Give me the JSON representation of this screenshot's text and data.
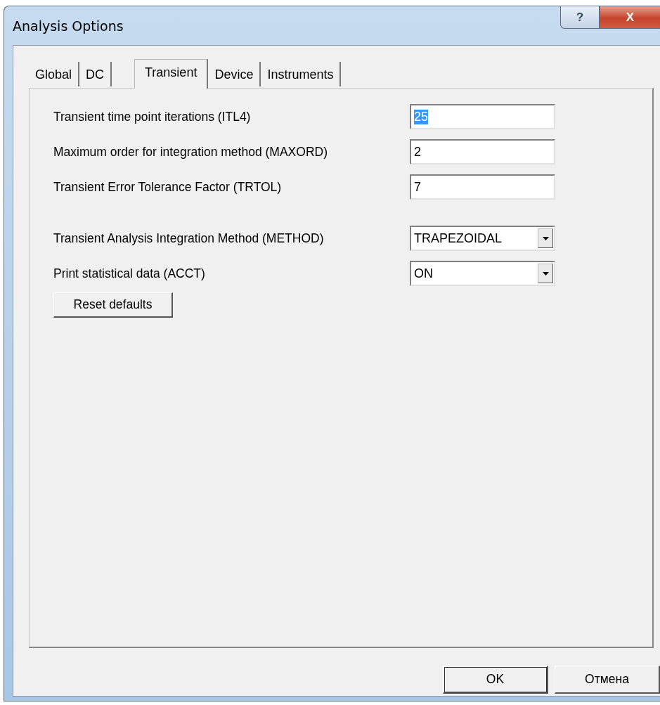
{
  "window": {
    "title": "Analysis Options",
    "buttons": [
      {
        "kind": "help",
        "label": "?"
      },
      {
        "kind": "close",
        "label": "X"
      }
    ]
  },
  "tabs": [
    {
      "label": "Global",
      "selected": false
    },
    {
      "label": "DC",
      "selected": false
    },
    {
      "label": "Transient",
      "selected": true
    },
    {
      "label": "Device",
      "selected": false
    },
    {
      "label": "Instruments",
      "selected": false
    }
  ],
  "field_groups": [
    [
      {
        "kind": "text",
        "label": "Transient time point iterations (ITL4)",
        "value": "25",
        "text_selected": true
      },
      {
        "kind": "text",
        "label": "Maximum order for integration method (MAXORD)",
        "value": "2",
        "text_selected": false
      },
      {
        "kind": "text",
        "label": "Transient Error Tolerance Factor (TRTOL)",
        "value": "7",
        "text_selected": false
      }
    ],
    [
      {
        "kind": "dropdown",
        "label": "Transient Analysis Integration Method (METHOD)",
        "value": "TRAPEZOIDAL"
      },
      {
        "kind": "dropdown",
        "label": "Print statistical data (ACCT)",
        "value": "ON"
      }
    ]
  ],
  "reset_button": "Reset defaults",
  "buttons": [
    {
      "label": "OK",
      "default": true
    },
    {
      "label": "Отмена",
      "default": false
    }
  ]
}
